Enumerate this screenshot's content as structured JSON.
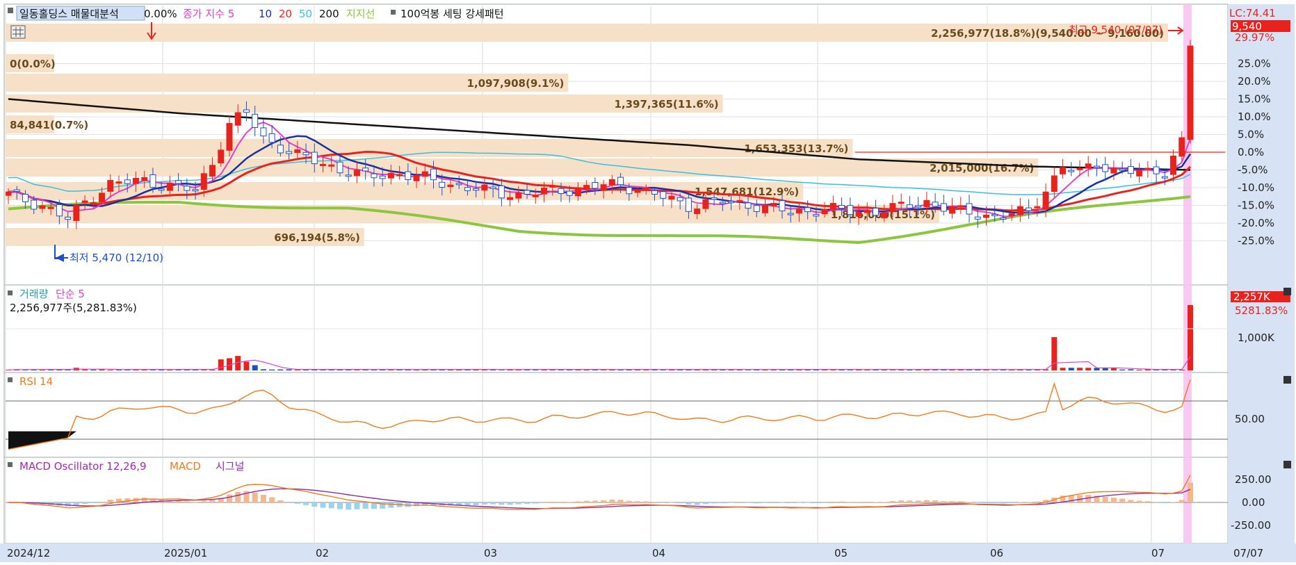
{
  "header": {
    "stock_name": "일동홀딩스 매물대분석",
    "overlay_extra": "0.00%",
    "ma_label": "종가 지수 5",
    "ma_periods": [
      "10",
      "20",
      "50",
      "200"
    ],
    "support_label": "지지선",
    "pattern_label": "100억봉 세팅 강세패턴"
  },
  "price_panel": {
    "lc_label": "LC:74.41",
    "current_price": "9,540",
    "current_pct": "29.97%",
    "high_label": "최고 9,540 (07/07)",
    "low_label": "최저 5,470 (12/10)",
    "y_ticks": [
      "25.0%",
      "20.0%",
      "15.0%",
      "10.0%",
      "5.0%",
      "0.0%",
      "-5.0%",
      "-10.0%",
      "-15.0%",
      "-20.0%",
      "-25.0%"
    ],
    "volume_profile": [
      {
        "text": "2,256,977(18.8%)(9,540.00 ~ 9,160.00)",
        "pct": 18.8
      },
      {
        "text": "0(0.0%)",
        "pct": 0.0
      },
      {
        "text": "1,097,908(9.1%)",
        "pct": 9.1
      },
      {
        "text": "1,397,365(11.6%)",
        "pct": 11.6
      },
      {
        "text": "84,841(0.7%)",
        "pct": 0.7
      },
      {
        "text": "1,653,353(13.7%)",
        "pct": 13.7
      },
      {
        "text": "2,015,000(16.7%)",
        "pct": 16.7
      },
      {
        "text": "1,547,681(12.9%)",
        "pct": 12.9
      },
      {
        "text": "1,816,000(15.1%)",
        "pct": 15.1
      },
      {
        "text": "696,194(5.8%)",
        "pct": 5.8
      }
    ]
  },
  "volume_panel": {
    "title": "거래량",
    "ma_label": "단순 5",
    "summary": "2,256,977주(5,281.83%)",
    "current_badge": "2,257K",
    "current_pct": "5281.83%",
    "tick": "1,000K"
  },
  "rsi_panel": {
    "title": "RSI 14",
    "tick": "50.00"
  },
  "macd_panel": {
    "title": "MACD Oscillator 12,26,9",
    "macd_label": "MACD",
    "signal_label": "시그널",
    "ticks": [
      "250.00",
      "0.00",
      "-250.00"
    ]
  },
  "x_axis": {
    "labels": [
      "2024/12",
      "2025/01",
      "02",
      "03",
      "04",
      "05",
      "06",
      "07"
    ],
    "cursor_date": "07/07"
  },
  "colors": {
    "up": "#e8231d",
    "down": "#1d4fc4",
    "ma5": "#e040c8",
    "ma10": "#1a2fa0",
    "ma20": "#e8231d",
    "ma50": "#35c0e0",
    "ma200": "#111111",
    "support": "#8cc63e",
    "rsi": "#f07a1e",
    "macd": "#f07a1e",
    "signal": "#8a2ca8",
    "highlight": "#f7c3f0",
    "profile": "#f6e1c8"
  },
  "chart_data": [
    {
      "type": "line",
      "title": "일동홀딩스",
      "x": [
        "2024/12",
        "2025/01",
        "02",
        "03",
        "04",
        "05",
        "06",
        "07/07"
      ],
      "y_axis_unit": "% vs reference close",
      "ylim": [
        -28,
        30
      ],
      "series": [
        {
          "name": "종가 지수 5",
          "values": [
            -12,
            5,
            -7,
            -12,
            -16,
            -17,
            -6,
            29.97
          ]
        },
        {
          "name": "200",
          "values": [
            15,
            11,
            8,
            5,
            2,
            -2,
            -4,
            -5
          ]
        },
        {
          "name": "지지선",
          "values": [
            -16,
            -14,
            -16,
            -22,
            -24,
            -25,
            -18,
            -12
          ]
        }
      ],
      "max_point": {
        "date": "07/07",
        "price": 9540
      },
      "min_point": {
        "date": "12/10",
        "price": 5470
      }
    },
    {
      "type": "bar",
      "title": "거래량",
      "latest_volume": 2256977,
      "latest_pct": 5281.83,
      "ylim": [
        0,
        2400000
      ]
    },
    {
      "type": "line",
      "title": "RSI 14",
      "ylim": [
        0,
        100
      ],
      "latest": 93
    },
    {
      "type": "bar",
      "title": "MACD Oscillator 12,26,9",
      "ylim": [
        -300,
        400
      ],
      "latest_macd": 350
    }
  ]
}
